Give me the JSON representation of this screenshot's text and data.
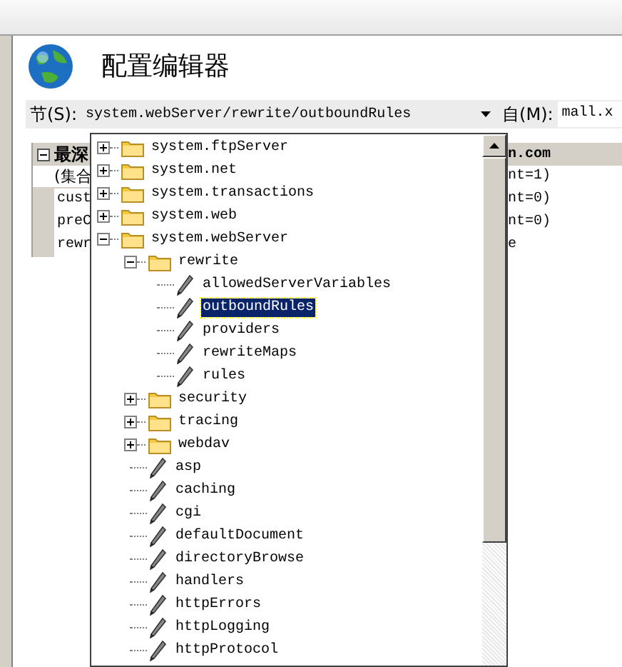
{
  "window": {
    "title": "配置编辑器"
  },
  "section": {
    "label": "节(S):",
    "value": "system.webServer/rewrite/outboundRules"
  },
  "from": {
    "label": "自(M):",
    "value": "mall.x"
  },
  "property_grid": {
    "header": {
      "column_1": "最深",
      "column_2": "n.com",
      "expanded": true
    },
    "rows": [
      {
        "column_1": "(集合",
        "column_2": "nt=1)",
        "kind": "collection"
      },
      {
        "column_1": "cust",
        "column_2": "nt=0)",
        "kind": "property"
      },
      {
        "column_1": "preC",
        "column_2": "nt=0)",
        "kind": "property"
      },
      {
        "column_1": "rewr",
        "column_2": "e",
        "kind": "property"
      }
    ]
  },
  "section_tree": [
    {
      "label": "system.ftpServer",
      "kind": "folder",
      "expanded": false,
      "selected": false
    },
    {
      "label": "system.net",
      "kind": "folder",
      "expanded": false,
      "selected": false
    },
    {
      "label": "system.transactions",
      "kind": "folder",
      "expanded": false,
      "selected": false
    },
    {
      "label": "system.web",
      "kind": "folder",
      "expanded": false,
      "selected": false
    },
    {
      "label": "system.webServer",
      "kind": "folder",
      "expanded": true,
      "selected": false,
      "children": [
        {
          "label": "rewrite",
          "kind": "folder",
          "expanded": true,
          "selected": false,
          "children": [
            {
              "label": "allowedServerVariables",
              "kind": "leaf",
              "selected": false
            },
            {
              "label": "outboundRules",
              "kind": "leaf",
              "selected": true
            },
            {
              "label": "providers",
              "kind": "leaf",
              "selected": false
            },
            {
              "label": "rewriteMaps",
              "kind": "leaf",
              "selected": false
            },
            {
              "label": "rules",
              "kind": "leaf",
              "selected": false
            }
          ]
        },
        {
          "label": "security",
          "kind": "folder",
          "expanded": false,
          "selected": false
        },
        {
          "label": "tracing",
          "kind": "folder",
          "expanded": false,
          "selected": false
        },
        {
          "label": "webdav",
          "kind": "folder",
          "expanded": false,
          "selected": false
        },
        {
          "label": "asp",
          "kind": "leaf",
          "selected": false
        },
        {
          "label": "caching",
          "kind": "leaf",
          "selected": false
        },
        {
          "label": "cgi",
          "kind": "leaf",
          "selected": false
        },
        {
          "label": "defaultDocument",
          "kind": "leaf",
          "selected": false
        },
        {
          "label": "directoryBrowse",
          "kind": "leaf",
          "selected": false
        },
        {
          "label": "handlers",
          "kind": "leaf",
          "selected": false
        },
        {
          "label": "httpErrors",
          "kind": "leaf",
          "selected": false
        },
        {
          "label": "httpLogging",
          "kind": "leaf",
          "selected": false
        },
        {
          "label": "httpProtocol",
          "kind": "leaf",
          "selected": false
        }
      ]
    }
  ]
}
